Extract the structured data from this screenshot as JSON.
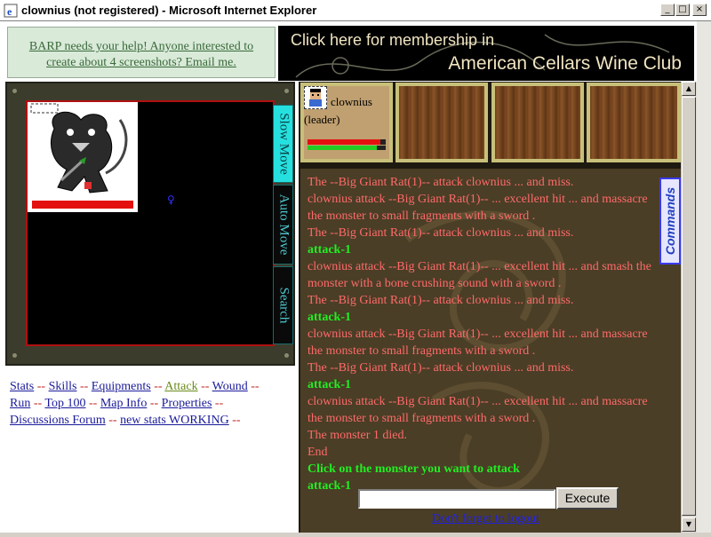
{
  "window": {
    "title": "clownius (not registered) - Microsoft Internet Explorer",
    "min_glyph": "_",
    "max_glyph": "□",
    "close_glyph": "×"
  },
  "banner_left": {
    "line1": "BARP needs your help! Anyone interested to",
    "line2": "create about 4 screenshots? Email me."
  },
  "banner_right": {
    "line1": "Click here for membership in",
    "line2": "American Cellars Wine Club"
  },
  "map": {
    "tabs": [
      {
        "label": "Slow Move",
        "active": true
      },
      {
        "label": "Auto Move",
        "active": false
      },
      {
        "label": "Search",
        "active": false
      }
    ],
    "monster_hp_fraction": 1.0
  },
  "links": [
    {
      "label": "Stats",
      "current": false
    },
    {
      "label": "Skills",
      "current": false
    },
    {
      "label": "Equipments",
      "current": false
    },
    {
      "label": "Attack",
      "current": true
    },
    {
      "label": "Wound",
      "current": false
    },
    {
      "label": "Run",
      "current": false
    },
    {
      "label": "Top 100",
      "current": false
    },
    {
      "label": "Map Info",
      "current": false
    },
    {
      "label": "Properties",
      "current": false
    },
    {
      "label": "Discussions Forum",
      "current": false
    },
    {
      "label": "new stats WORKING",
      "current": false
    }
  ],
  "links_separator": "--",
  "party": {
    "member_name": "clownius",
    "member_role": "(leader)",
    "hp_fraction": 0.93,
    "mp_fraction": 0.89
  },
  "log": [
    {
      "text": "The --Big Giant Rat(1)-- attack clownius ... and miss.",
      "type": "combat"
    },
    {
      "text": "clownius attack --Big Giant Rat(1)-- ... excellent hit ... and massacre the monster to small fragments with a sword .",
      "type": "combat"
    },
    {
      "text": "The --Big Giant Rat(1)-- attack clownius ... and miss.",
      "type": "combat"
    },
    {
      "text": "attack-1",
      "type": "action"
    },
    {
      "text": "clownius attack --Big Giant Rat(1)-- ... excellent hit ... and smash the monster with a bone crushing sound with a sword .",
      "type": "combat"
    },
    {
      "text": "The --Big Giant Rat(1)-- attack clownius ... and miss.",
      "type": "combat"
    },
    {
      "text": "attack-1",
      "type": "action"
    },
    {
      "text": "clownius attack --Big Giant Rat(1)-- ... excellent hit ... and massacre the monster to small fragments with a sword .",
      "type": "combat"
    },
    {
      "text": "The --Big Giant Rat(1)-- attack clownius ... and miss.",
      "type": "combat"
    },
    {
      "text": "attack-1",
      "type": "action"
    },
    {
      "text": "clownius attack --Big Giant Rat(1)-- ... excellent hit ... and massacre the monster to small fragments with a sword .",
      "type": "combat"
    },
    {
      "text": "The monster 1 died.",
      "type": "combat"
    },
    {
      "text": "End",
      "type": "combat"
    },
    {
      "text": "Click on the monster you want to attack",
      "type": "action"
    },
    {
      "text": "attack-1",
      "type": "action"
    }
  ],
  "commands_tab": "Commands",
  "command_input": {
    "value": "",
    "placeholder": ""
  },
  "execute_label": "Execute",
  "logout_label": "Don't forget to logout",
  "colors": {
    "log_combat": "#ff6a6a",
    "log_action": "#22ee22",
    "map_border": "#b01010",
    "tab_active": "#26e0e0"
  }
}
